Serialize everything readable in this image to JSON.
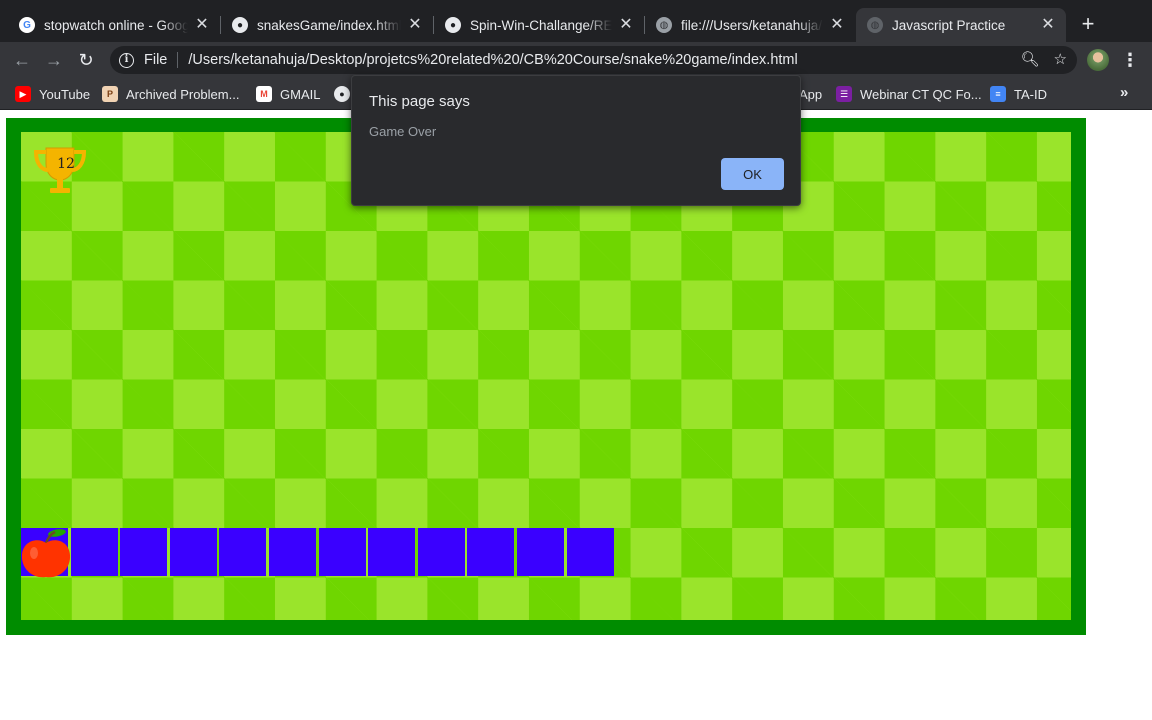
{
  "tabs": [
    {
      "title": "stopwatch online - Google Search",
      "favicon": "google-icon",
      "active": false
    },
    {
      "title": "snakesGame/index.html at master",
      "favicon": "github-icon",
      "active": false
    },
    {
      "title": "Spin-Win-Challange/README.md",
      "favicon": "github-icon",
      "active": false
    },
    {
      "title": "file:///Users/ketanahuja/Desktop",
      "favicon": "globe-icon",
      "active": false
    },
    {
      "title": "Javascript Practice",
      "favicon": "globe-icon",
      "active": true
    }
  ],
  "address_bar": {
    "scheme": "File",
    "url": "/Users/ketanahuja/Desktop/projetcs%20related%20/CB%20Course/snake%20game/index.html"
  },
  "bookmarks": [
    {
      "label": "YouTube",
      "icon": "youtube-icon"
    },
    {
      "label": "Archived Problem...",
      "icon": "archive-icon"
    },
    {
      "label": "GMAIL",
      "icon": "gmail-icon"
    },
    {
      "label": "App",
      "icon": "app-icon"
    },
    {
      "label": "Webinar CT QC Fo...",
      "icon": "forms-icon"
    },
    {
      "label": "TA-ID",
      "icon": "docs-icon"
    }
  ],
  "dialog": {
    "title": "This page says",
    "message": "Game Over",
    "ok_label": "OK"
  },
  "game": {
    "score": "12",
    "snake_length": 12,
    "colors": {
      "frame": "#008c00",
      "light_tile": "#9ae42b",
      "dark_tile": "#6fd600",
      "snake": "#3a00ff",
      "food": "#ff3300"
    }
  }
}
